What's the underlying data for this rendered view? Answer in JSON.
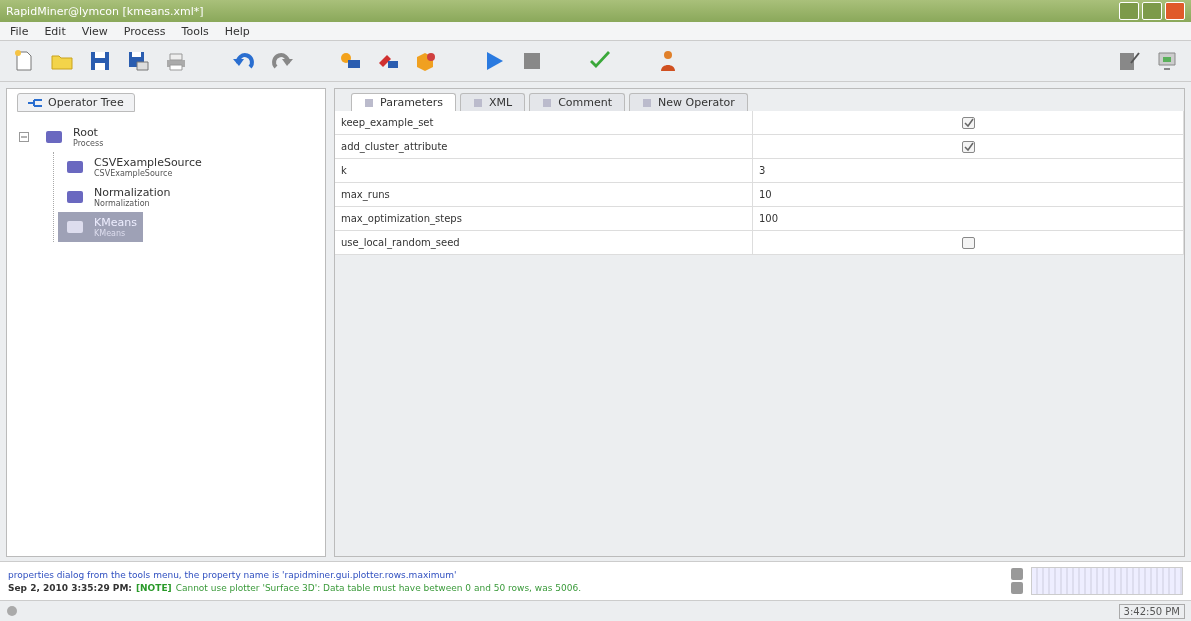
{
  "window": {
    "title": "RapidMiner@lymcon [kmeans.xml*]"
  },
  "menu": [
    "File",
    "Edit",
    "View",
    "Process",
    "Tools",
    "Help"
  ],
  "left_panel": {
    "tab": "Operator Tree",
    "tree": [
      {
        "name": "Root",
        "type": "Process",
        "selected": false,
        "expanded": true,
        "children": [
          {
            "name": "CSVExampleSource",
            "type": "CSVExampleSource",
            "selected": false
          },
          {
            "name": "Normalization",
            "type": "Normalization",
            "selected": false
          },
          {
            "name": "KMeans",
            "type": "KMeans",
            "selected": true
          }
        ]
      }
    ]
  },
  "right_panel": {
    "tabs": [
      {
        "label": "Parameters",
        "selected": true
      },
      {
        "label": "XML",
        "selected": false
      },
      {
        "label": "Comment",
        "selected": false
      },
      {
        "label": "New Operator",
        "selected": false
      }
    ],
    "parameters": [
      {
        "name": "keep_example_set",
        "kind": "checkbox",
        "checked": true
      },
      {
        "name": "add_cluster_attribute",
        "kind": "checkbox",
        "checked": true
      },
      {
        "name": "k",
        "kind": "text",
        "value": "3"
      },
      {
        "name": "max_runs",
        "kind": "text",
        "value": "10"
      },
      {
        "name": "max_optimization_steps",
        "kind": "text",
        "value": "100"
      },
      {
        "name": "use_local_random_seed",
        "kind": "checkbox",
        "checked": false
      }
    ]
  },
  "log": [
    "properties dialog from the tools menu, the property name is 'rapidminer.gui.plotter.rows.maximum'"
  ],
  "log_entry": {
    "timestamp": "Sep 2, 2010 3:35:29 PM:",
    "level": "[NOTE]",
    "message": "Cannot use plotter 'Surface 3D': Data table must have between 0 and 50 rows, was 5006."
  },
  "status_bar": {
    "time": "3:42:50 PM"
  }
}
